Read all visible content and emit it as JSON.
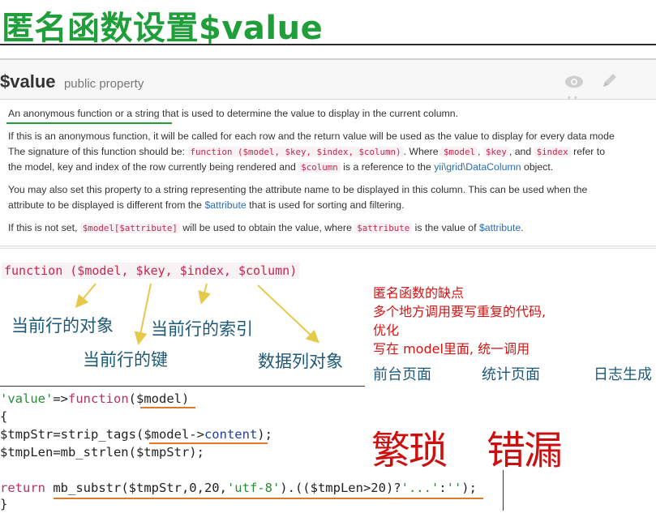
{
  "slide": {
    "title": "匿名函数设置$value"
  },
  "doc": {
    "property_name": "$value",
    "property_type": "public property",
    "icons": [
      "eye-icon",
      "pencil-icon",
      "hash-icon"
    ],
    "p1": "An anonymous function or a string that is used to determine the value to display in the current column.",
    "p2_a": "If this is an anonymous function, it will be called for each row and the return value will be used as the value to display for every data mode",
    "p2_b1": "The signature of this function should be:",
    "p2_code1": "function ($model, $key, $index, $column)",
    "p2_b2": ". Where",
    "p2_code2": "$model",
    "p2_code3": "$key",
    "p2_b3": ", and",
    "p2_code4": "$index",
    "p2_b4": "refer to",
    "p2_c1": "the model, key and index of the row currently being rendered and",
    "p2_code5": "$column",
    "p2_c2": "is a reference to the",
    "p2_link1": "yii\\grid\\DataColumn",
    "p2_c3": "object.",
    "p3_a1": "You may also set this property to a string representing the attribute name to be displayed in this column. This can be used when the",
    "p3_b1": "attribute to be displayed is different from the",
    "p3_link": "$attribute",
    "p3_b2": "that is used for sorting and filtering.",
    "p4_a": "If this is not set,",
    "p4_code1": "$model[$attribute]",
    "p4_b": "will be used to obtain the value, where",
    "p4_code2": "$attribute",
    "p4_c": "is the value of",
    "p4_link": "$attribute",
    "p4_d": "."
  },
  "annotations": {
    "signature": "function ($model, $key, $index, $column)",
    "model_note": "当前行的对象",
    "key_note": "当前行的键",
    "index_note": "当前行的索引",
    "column_note": "数据列对象"
  },
  "drawbacks": {
    "line1": "匿名函数的缺点",
    "line2": "多个地方调用要写重复的代码,",
    "line3": "优化",
    "line4": "写在 model里面, 统一调用",
    "page1": "前台页面",
    "page2": "统计页面",
    "page3": "日志生成",
    "cons1": "繁琐",
    "cons2": "错漏"
  },
  "code": {
    "l1a": "'value'",
    "l1b": "=>",
    "l1c": "function",
    "l1d": "($model)",
    "l2": "{",
    "l3a": "$tmpStr=strip_tags(",
    "l3b": "$model->",
    "l3c": "content",
    "l3d": ");",
    "l4": "$tmpLen=mb_strlen($tmpStr);",
    "l5a": "return",
    "l5b": " mb_substr($tmpStr,0,20,",
    "l5c": "'utf-8'",
    "l5d": ").(($tmpLen>20)?",
    "l5e": "'...'",
    "l5f": ":",
    "l5g": "''",
    "l5h": ");",
    "l6": "}"
  }
}
